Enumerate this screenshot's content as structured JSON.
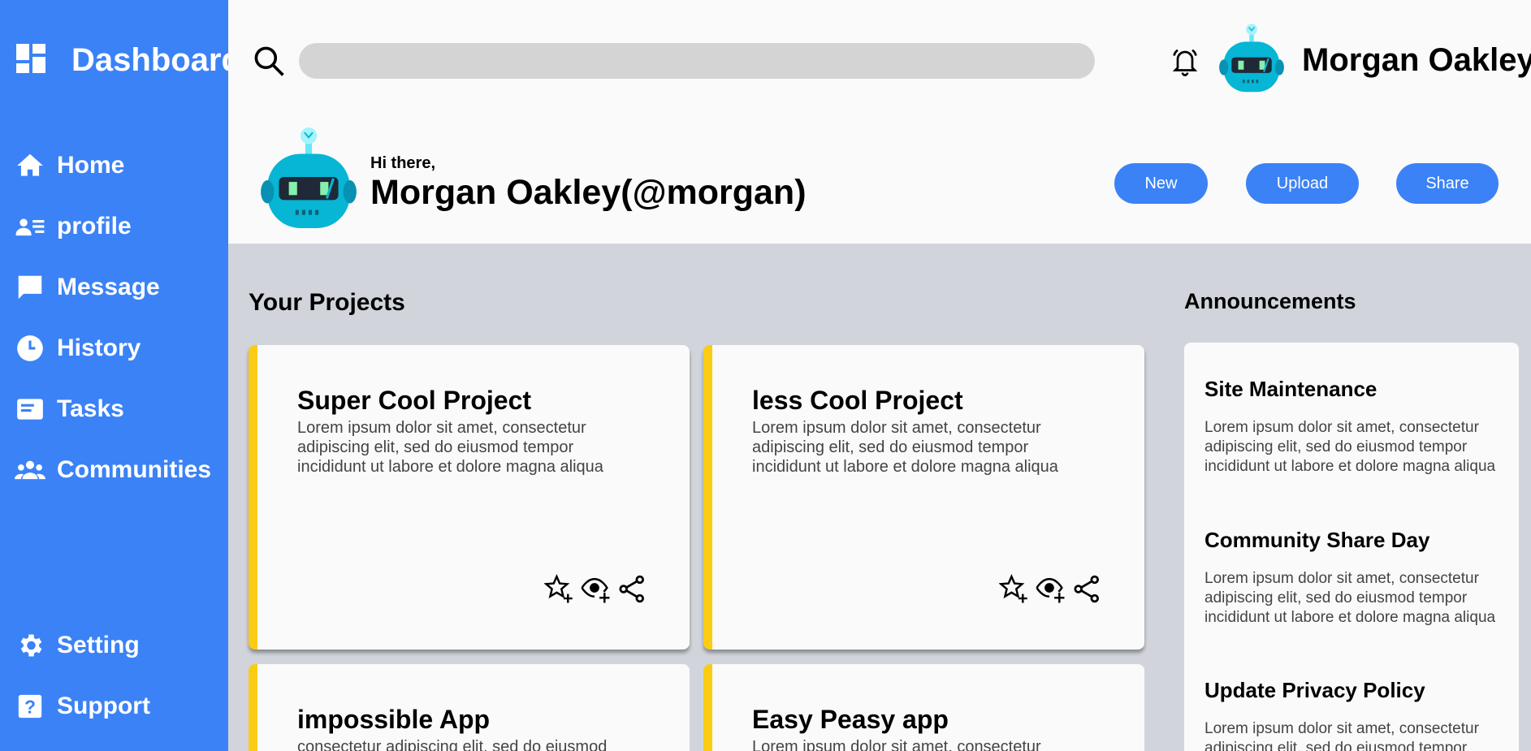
{
  "sidebar": {
    "brand": "Dashboard",
    "items": [
      {
        "label": "Home",
        "icon": "home-icon"
      },
      {
        "label": "profile",
        "icon": "profile-icon"
      },
      {
        "label": "Message",
        "icon": "message-icon"
      },
      {
        "label": "History",
        "icon": "clock-icon"
      },
      {
        "label": "Tasks",
        "icon": "tasks-icon"
      },
      {
        "label": "Communities",
        "icon": "people-icon"
      }
    ],
    "bottom_items": [
      {
        "label": "Setting",
        "icon": "gear-icon"
      },
      {
        "label": "Support",
        "icon": "help-icon"
      }
    ]
  },
  "header": {
    "search_placeholder": "",
    "username": "Morgan Oakley"
  },
  "greeting": {
    "small": "Hi there,",
    "name": "Morgan Oakley(@morgan)"
  },
  "actions": {
    "new": "New",
    "upload": "Upload",
    "share": "Share"
  },
  "projects": {
    "title": "Your Projects",
    "items": [
      {
        "title": "Super Cool Project",
        "desc": "Lorem ipsum dolor sit amet, consectetur adipiscing elit, sed do eiusmod tempor incididunt ut labore et dolore magna aliqua"
      },
      {
        "title": "less Cool Project",
        "desc": "Lorem ipsum dolor sit amet, consectetur adipiscing elit, sed do eiusmod tempor incididunt ut labore et dolore magna aliqua"
      },
      {
        "title": "impossible App",
        "desc": "consectetur adipiscing elit, sed do eiusmod"
      },
      {
        "title": "Easy Peasy app",
        "desc": "Lorem ipsum dolor sit amet, consectetur"
      }
    ]
  },
  "announcements": {
    "title": "Announcements",
    "items": [
      {
        "title": "Site Maintenance",
        "body": "Lorem ipsum dolor sit amet, consectetur adipiscing elit, sed do eiusmod tempor incididunt ut labore et dolore magna aliqua"
      },
      {
        "title": "Community Share Day",
        "body": "Lorem ipsum dolor sit amet, consectetur adipiscing elit, sed do eiusmod tempor incididunt ut labore et dolore magna aliqua"
      },
      {
        "title": "Update Privacy Policy",
        "body": "Lorem ipsum dolor sit amet, consectetur adipiscing elit, sed do eiusmod tempor"
      }
    ]
  },
  "colors": {
    "accent": "#3b82f6",
    "card_stripe": "#facc15",
    "background": "#d1d5db",
    "avatar": "#06b6d4"
  }
}
